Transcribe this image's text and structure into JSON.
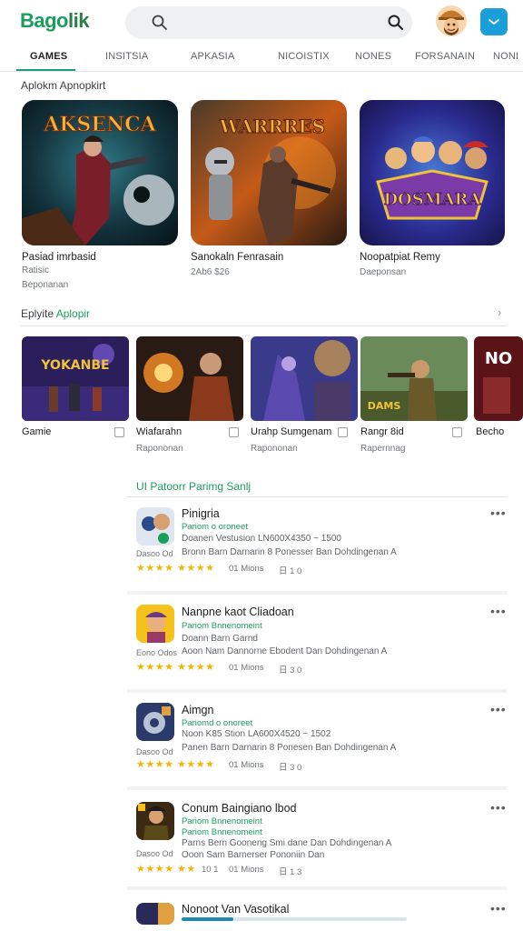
{
  "header": {
    "logo_part1": "Bago",
    "logo_part2": "lik"
  },
  "tabs": [
    {
      "label": "GAMES",
      "active": true
    },
    {
      "label": "INSITSIA",
      "active": false
    },
    {
      "label": "APKASIA",
      "active": false
    },
    {
      "label": "NICOISTIX",
      "active": false
    },
    {
      "label": "NONES",
      "active": false
    },
    {
      "label": "FORSANAIN",
      "active": false
    },
    {
      "label": "NONI",
      "active": false
    }
  ],
  "section1": {
    "title": "Aplokm Apnopkirt"
  },
  "big_cards": [
    {
      "art_text": "AKSENCA",
      "title": "Pasiad imrbasid",
      "meta1": "Ratisic",
      "meta2": "Beponanan"
    },
    {
      "art_text": "WARRRES",
      "title": "Sanokaln Fenrasain",
      "meta1": "2Ab6 $26",
      "meta2": ""
    },
    {
      "art_text": "DOSMARA",
      "title": "Noopatpiat Remy",
      "meta1": "Daeponsan",
      "meta2": ""
    }
  ],
  "section2": {
    "title_plain": "Eplyite ",
    "title_accent": "Aplopir",
    "chevron": "›"
  },
  "small_cards": [
    {
      "art_text": "YOKANBE",
      "title": "Gamie",
      "meta": ""
    },
    {
      "art_text": "",
      "title": "Wiafarahn",
      "meta": "Rapononan"
    },
    {
      "art_text": "",
      "title": "Urahp Sumgenam",
      "meta": "Rapononan"
    },
    {
      "art_text": "DAMS",
      "title": "Rangr 8id",
      "meta": "Rapernnag"
    },
    {
      "art_text": "NO",
      "title": "Becho",
      "meta": ""
    }
  ],
  "section3": {
    "title": "UI Patoorr Parimg Sanlj"
  },
  "list_rows": [
    {
      "title": "Pinigria",
      "sub": "Pariom o oroneet",
      "desc1": "Doanen Vestusion LN600X4350 ~ 1500",
      "desc2": "Bronn Barn Darnarin 8 Ponesser Ban Dohdingenan A",
      "left": "Dasoo Od",
      "stars": "★★★★ ★★★★",
      "count": "01 Mions",
      "size": "日 1 0"
    },
    {
      "title": "Nanpne kaot Cliadoan",
      "sub": "Pariom Bnnenomeint",
      "desc1": "Doann Barn Garnd",
      "desc2": "Aoon Nam Dannorne Ebodent Dan Dohdingenan A",
      "left": "Eono Odos",
      "stars": "★★★★ ★★★★",
      "count": "01 Mions",
      "size": "日 3 0"
    },
    {
      "title": "Aimgn",
      "sub": "Pariomd o onoreet",
      "desc1": "Noon K85 Stion LA600X4520 ~ 1502",
      "desc2": "Panen Barn Darnarin 8 Ponesen Ban Dohdingenan A",
      "left": "Dasoo Od",
      "stars": "★★★★ ★★★★",
      "count": "01 Mions",
      "size": "日 3 0"
    },
    {
      "title": "Conum Baingiano lbod",
      "sub": "Pariom Bnnenomeint",
      "desc1": "Parns Bern Gooneng Smi dane Dan Dohdingenan A",
      "desc2": "Ooon Sam Barnerser Pononiin Dan",
      "left": "Dasoo Od",
      "stars": "★★★★ ★★",
      "extra": "10 1",
      "count": "01 Mions",
      "size": "日 1 3"
    },
    {
      "title": "Nonoot Van Vasotikal",
      "progress": 0.23
    }
  ],
  "colors": {
    "accent": "#1a9e5c",
    "teal": "#1a9e8a",
    "menu_button": "#1a9fd9",
    "star": "#f4b400"
  },
  "icons": [
    "search-icon",
    "search-icon-right",
    "avatar",
    "menu-icon",
    "chevron-right-icon",
    "more-icon",
    "bookmark-icon"
  ]
}
